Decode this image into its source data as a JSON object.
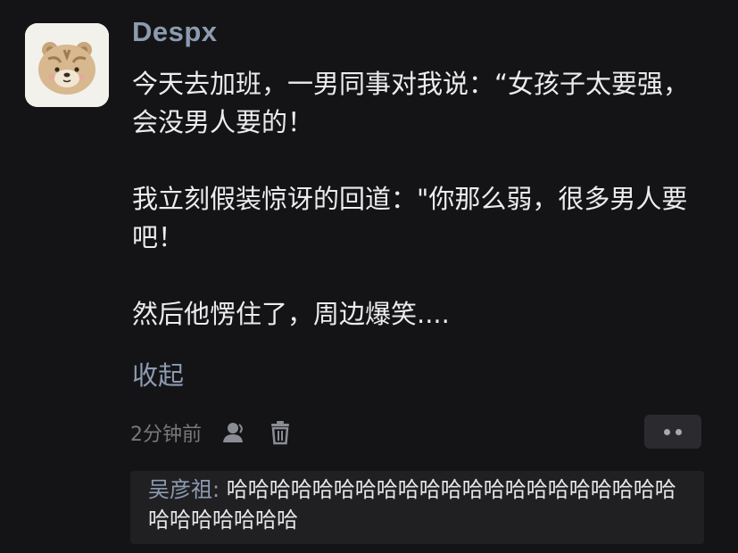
{
  "post": {
    "username": "Despx",
    "paragraphs": [
      "今天去加班，一男同事对我说：“女孩子太要强，会没男人要的！",
      "我立刻假装惊讶的回道：\"你那么弱，很多男人要吧！",
      "然后他愣住了，周边爆笑...."
    ],
    "collapse_label": "收起",
    "timestamp": "2分钟前",
    "icons": {
      "avatar": "bear-avatar-icon",
      "profile": "user-icon",
      "delete": "trash-icon",
      "more": "more-dots-icon"
    }
  },
  "reply": {
    "author": "吴彦祖:",
    "text": " 哈哈哈哈哈哈哈哈哈哈哈哈哈哈哈哈哈哈哈哈哈哈哈哈哈哈哈哈"
  },
  "colors": {
    "background": "#141416",
    "accent": "#8d9bb0",
    "text": "#ececee",
    "muted": "#77777d",
    "reply_bg": "#202023"
  }
}
